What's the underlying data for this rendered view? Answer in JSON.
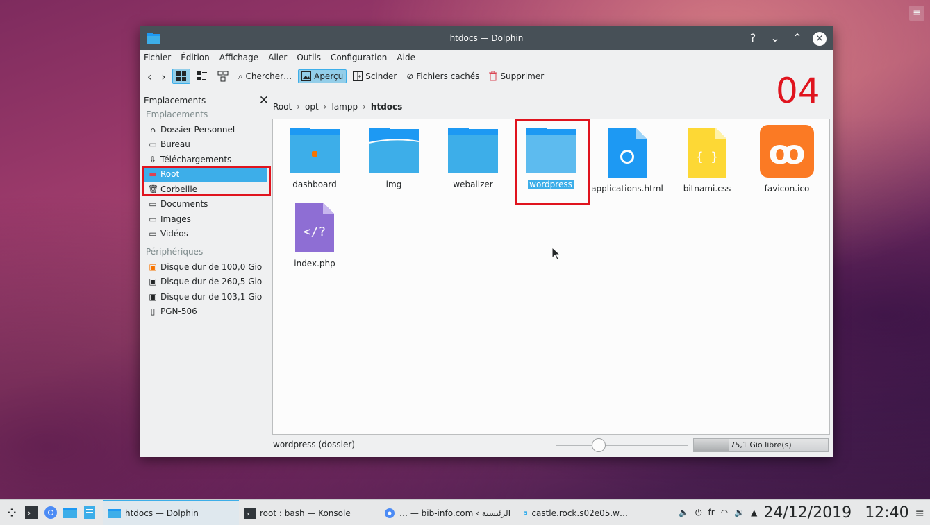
{
  "window": {
    "title": "htdocs — Dolphin"
  },
  "menu": [
    "Fichier",
    "Édition",
    "Affichage",
    "Aller",
    "Outils",
    "Configuration",
    "Aide"
  ],
  "toolbar": {
    "search": "Chercher…",
    "preview": "Aperçu",
    "split": "Scinder",
    "hidden": "Fichiers cachés",
    "delete": "Supprimer"
  },
  "panel": {
    "title": "Emplacements",
    "section_places": "Emplacements",
    "places": [
      "Dossier Personnel",
      "Bureau",
      "Téléchargements",
      "Root",
      "Corbeille",
      "Documents",
      "Images",
      "Vidéos"
    ],
    "section_devices": "Périphériques",
    "devices": [
      "Disque dur de 100,0 Gio",
      "Disque dur de 260,5 Gio",
      "Disque dur de 103,1 Gio",
      "PGN-506"
    ]
  },
  "breadcrumb": [
    "Root",
    "opt",
    "lampp",
    "htdocs"
  ],
  "files": [
    {
      "name": "dashboard",
      "icon": "folder-xampp-icon"
    },
    {
      "name": "img",
      "icon": "folder-open-icon"
    },
    {
      "name": "webalizer",
      "icon": "folder-icon"
    },
    {
      "name": "wordpress",
      "icon": "folder-icon"
    },
    {
      "name": "applications.html",
      "icon": "html-file-icon"
    },
    {
      "name": "bitnami.css",
      "icon": "css-file-icon"
    },
    {
      "name": "favicon.ico",
      "icon": "xampp-logo-icon"
    },
    {
      "name": "index.php",
      "icon": "php-file-icon"
    }
  ],
  "status": {
    "text": "wordpress (dossier)",
    "free_space": "75,1 Gio libre(s)",
    "zoom_level": 0.3,
    "disk_used_fraction": 0.26
  },
  "annotation": {
    "step": "04",
    "color": "#e0141e"
  },
  "taskbar": {
    "tasks": [
      "htdocs — Dolphin",
      "root : bash — Konsole",
      "… — bib-info.com ‹ الرئيسية",
      "castle.rock.s02e05.w…"
    ],
    "lang": "fr",
    "date": "24/12/2019",
    "time": "12:40"
  },
  "colors": {
    "accent": "#3daee9",
    "titlebar": "#475057",
    "folder": "#1d99f3"
  }
}
